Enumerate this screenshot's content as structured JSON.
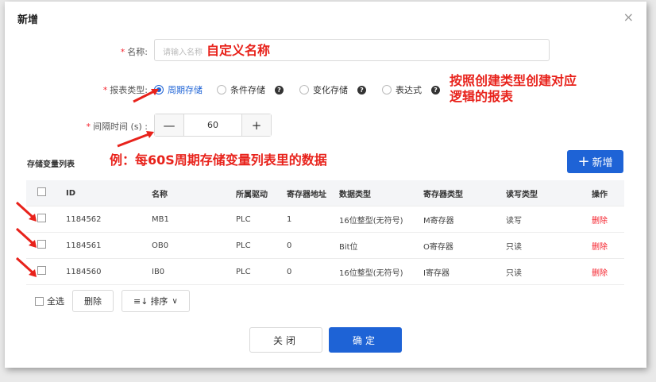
{
  "dialog": {
    "title": "新增",
    "close_glyph": "×"
  },
  "form": {
    "name_label": "名称:",
    "name_placeholder": "请输入名称",
    "type_label": "报表类型:",
    "types": [
      "周期存储",
      "条件存储",
      "变化存储",
      "表达式"
    ],
    "selected_type": "周期存储",
    "interval_label": "间隔时间 (s) :",
    "interval_value": "60",
    "minus": "—",
    "plus": "+"
  },
  "annotations": {
    "name_note": "自定义名称",
    "type_note_line1": "按照创建类型创建对应",
    "type_note_line2": "逻辑的报表",
    "interval_note": "例：每60S周期存储变量列表里的数据"
  },
  "variables": {
    "section_title": "存储变量列表",
    "add_label": "新增",
    "columns": [
      "ID",
      "名称",
      "所属驱动",
      "寄存器地址",
      "数据类型",
      "寄存器类型",
      "读写类型",
      "操作"
    ],
    "rows": [
      {
        "id": "1184562",
        "name": "MB1",
        "driver": "PLC",
        "addr": "1",
        "dtype": "16位整型(无符号)",
        "rtype": "M寄存器",
        "rw": "读写",
        "op": "删除"
      },
      {
        "id": "1184561",
        "name": "OB0",
        "driver": "PLC",
        "addr": "0",
        "dtype": "Bit位",
        "rtype": "O寄存器",
        "rw": "只读",
        "op": "删除"
      },
      {
        "id": "1184560",
        "name": "IB0",
        "driver": "PLC",
        "addr": "0",
        "dtype": "16位整型(无符号)",
        "rtype": "I寄存器",
        "rw": "只读",
        "op": "删除"
      }
    ],
    "select_all": "全选",
    "delete": "删除",
    "sort": "排序",
    "sort_icon": "≡↓",
    "sort_caret": "∨"
  },
  "footer": {
    "close": "关闭",
    "confirm": "确定"
  },
  "colors": {
    "primary": "#1e63d6",
    "danger": "#f5222d",
    "annotation": "#e8221b"
  }
}
